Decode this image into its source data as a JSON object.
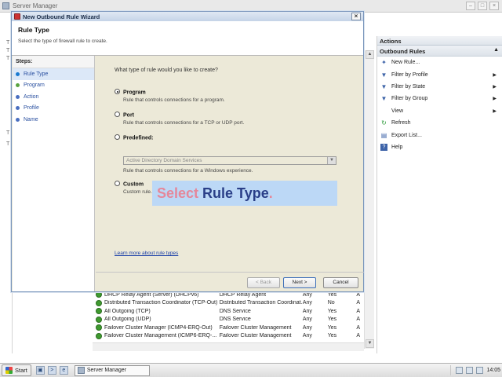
{
  "server_manager": {
    "title": "Server Manager",
    "left_labels": [
      "T",
      "T",
      "T",
      "T",
      "T"
    ]
  },
  "actions_pane": {
    "header": "Actions",
    "section": "Outbound Rules",
    "items": [
      {
        "label": "New Rule...",
        "icon": "new-rule-icon",
        "submenu": false
      },
      {
        "label": "Filter by Profile",
        "icon": "filter-icon",
        "submenu": true
      },
      {
        "label": "Filter by State",
        "icon": "filter-icon",
        "submenu": true
      },
      {
        "label": "Filter by Group",
        "icon": "filter-icon",
        "submenu": true
      },
      {
        "label": "View",
        "icon": "",
        "submenu": true
      },
      {
        "label": "Refresh",
        "icon": "refresh-icon",
        "submenu": false
      },
      {
        "label": "Export List...",
        "icon": "export-icon",
        "submenu": false
      },
      {
        "label": "Help",
        "icon": "help-icon",
        "submenu": false
      }
    ]
  },
  "rule_rows": [
    {
      "name": "DHCP Relay Agent (Server) (DHCPv6)",
      "group": "DHCP Relay Agent",
      "profile": "Any",
      "enabled": "Yes",
      "action": "A"
    },
    {
      "name": "Distributed Transaction Coordinator (TCP-Out)",
      "group": "Distributed Transaction Coordinat...",
      "profile": "Any",
      "enabled": "No",
      "action": "A"
    },
    {
      "name": "All Outgoing (TCP)",
      "group": "DNS Service",
      "profile": "Any",
      "enabled": "Yes",
      "action": "A"
    },
    {
      "name": "All Outgoing (UDP)",
      "group": "DNS Service",
      "profile": "Any",
      "enabled": "Yes",
      "action": "A"
    },
    {
      "name": "Failover Cluster Manager (ICMP4-ERQ-Out)",
      "group": "Failover Cluster Management",
      "profile": "Any",
      "enabled": "Yes",
      "action": "A"
    },
    {
      "name": "Failover Cluster Management (ICMP6-ERQ-...",
      "group": "Failover Cluster Management",
      "profile": "Any",
      "enabled": "Yes",
      "action": "A"
    }
  ],
  "wizard": {
    "title": "New Outbound Rule Wizard",
    "heading": "Rule Type",
    "subheading": "Select the type of firewall rule to create.",
    "steps_header": "Steps:",
    "steps": [
      "Rule Type",
      "Program",
      "Action",
      "Profile",
      "Name"
    ],
    "question": "What type of rule would you like to create?",
    "options": [
      {
        "label": "Program",
        "desc": "Rule that controls connections for a program.",
        "selected": true
      },
      {
        "label": "Port",
        "desc": "Rule that controls connections for a TCP or UDP port.",
        "selected": false
      },
      {
        "label": "Predefined:",
        "desc": "Rule that controls connections for a Windows experience.",
        "selected": false
      },
      {
        "label": "Custom",
        "desc": "Custom rule.",
        "selected": false
      }
    ],
    "predefined_value": "Active Directory Domain Services",
    "learn_link": "Learn more about rule types",
    "back_label": "< Back",
    "next_label": "Next >",
    "cancel_label": "Cancel"
  },
  "overlay": {
    "word1": "Select",
    "rest": " Rule Type",
    "dot": "."
  },
  "taskbar": {
    "start_label": "Start",
    "task_label": "Server Manager",
    "clock": "14:05"
  }
}
